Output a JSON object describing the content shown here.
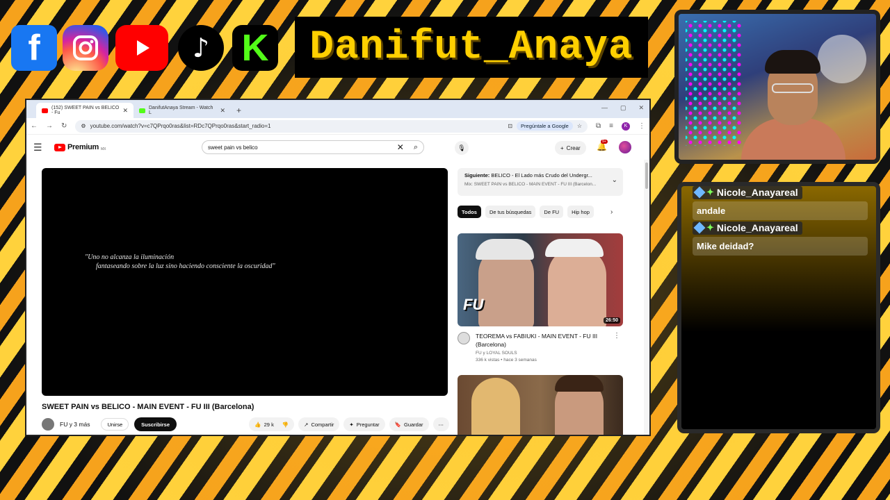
{
  "overlay": {
    "banner_text": "Danifut_Anaya",
    "social_icons": [
      "facebook-icon",
      "instagram-icon",
      "youtube-icon",
      "tiktok-icon",
      "kick-icon"
    ],
    "accent_color": "#ffd000"
  },
  "chat": {
    "messages": [
      {
        "user": "Nicole_Anayareal",
        "text": "andale"
      },
      {
        "user": "Nicole_Anayareal",
        "text": "Mike deidad?"
      }
    ]
  },
  "browser": {
    "tabs": [
      {
        "label": "(152) SWEET PAIN vs BELICO - Fu",
        "active": true
      },
      {
        "label": "DanifutAnaya Stream - Watch L",
        "active": false
      }
    ],
    "new_tab": "+",
    "url": "youtube.com/watch?v=c7QPrqo0ras&list=RDc7QPrqo0ras&start_radio=1",
    "ask_google": "Pregúntale a Google",
    "profile_initial": "K"
  },
  "youtube": {
    "brand": "Premium",
    "region": "MX",
    "search_query": "sweet pain vs belico",
    "create_label": "Crear",
    "notifications": "9+",
    "player_quote_line1": "\"Uno no alcanza la iluminación",
    "player_quote_line2": "fantaseando sobre la luz sino haciendo consciente la oscuridad\"",
    "video_title": "SWEET PAIN vs BELICO - MAIN EVENT - FU III (Barcelona)",
    "channel": "FU y 3 más",
    "join_label": "Unirse",
    "subscribe_label": "Suscribirse",
    "likes": "29 k",
    "share_label": "Compartir",
    "ask_label": "Preguntar",
    "save_label": "Guardar",
    "up_next_label": "Siguiente:",
    "up_next_title": "BELICO - El Lado más Crudo del Undergr...",
    "up_next_mix": "Mix: SWEET PAIN vs BELICO - MAIN EVENT - FU III (Barcelon...",
    "chips": [
      {
        "label": "Todos",
        "active": true
      },
      {
        "label": "De tus búsquedas",
        "active": false
      },
      {
        "label": "De FU",
        "active": false
      },
      {
        "label": "Hip hop",
        "active": false
      }
    ],
    "rec1": {
      "title": "TEOREMA vs FABIUKI - MAIN EVENT - FU III (Barcelona)",
      "channel": "FU y LOYAL SOULS",
      "meta": "336 k vistas • hace 3 semanas",
      "duration": "26:50",
      "thumb_text": "FU"
    }
  }
}
